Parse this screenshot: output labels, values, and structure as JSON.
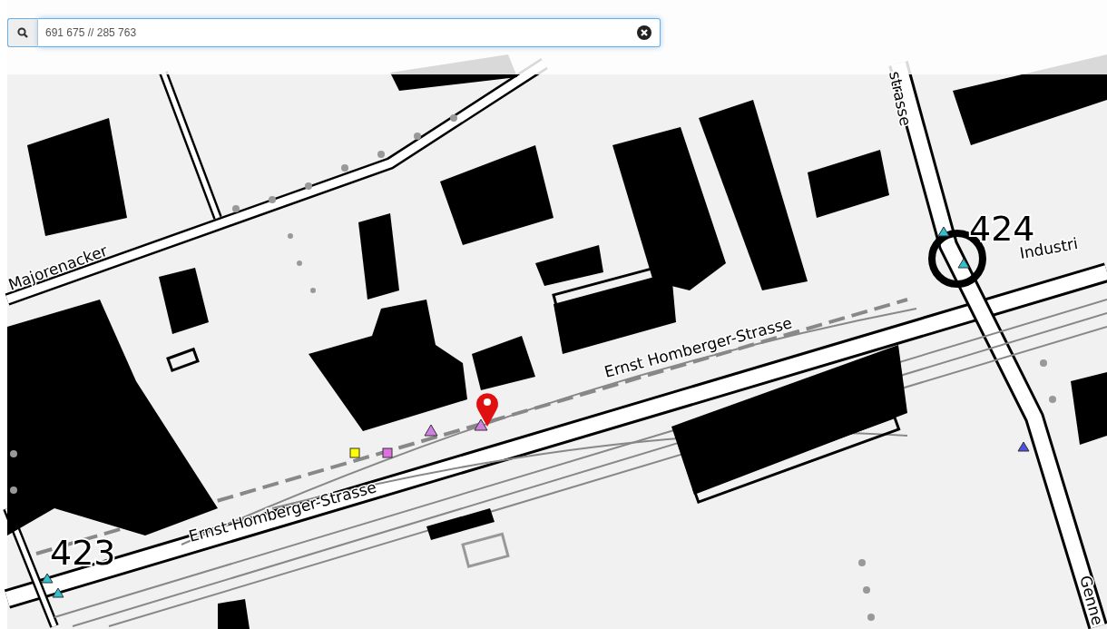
{
  "search": {
    "value": "691 675 // 285 763"
  },
  "map": {
    "labels": [
      {
        "text": "Majorenacker",
        "kind": "street"
      },
      {
        "text": "Ernst Homberger-Strasse",
        "kind": "street"
      },
      {
        "text": "Ernst Homberger-Strasse",
        "kind": "street"
      },
      {
        "text": "424",
        "kind": "height"
      },
      {
        "text": "423",
        "kind": "height"
      },
      {
        "text": "Industri",
        "kind": "street"
      },
      {
        "text": "strasse",
        "kind": "street"
      },
      {
        "text": "Genne",
        "kind": "street"
      }
    ]
  }
}
